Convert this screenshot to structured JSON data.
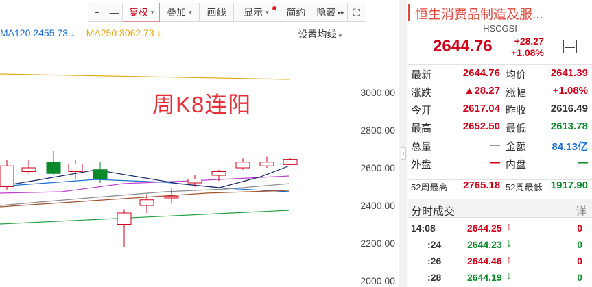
{
  "toolbar": {
    "zoom_in": "+",
    "zoom_out": "—",
    "fuquan": "复权",
    "diejia": "叠加",
    "huaxian": "画线",
    "xianshi": "显示",
    "jianyue": "简约",
    "yincang": "隐藏",
    "forward": "▸▸",
    "fullscreen": "⛶"
  },
  "ma_legend": {
    "ma120": "MA120:2455.73",
    "ma250": "MA250:3062.73",
    "arrow": "↓",
    "settings": "设置均线"
  },
  "annotation": "周K8连阳",
  "y_ticks": [
    "3000.00",
    "2800.00",
    "2600.00",
    "2400.00",
    "2200.00",
    "2000.00"
  ],
  "colors": {
    "up": "#d0021b",
    "down": "#0a8a2a",
    "ma120": "#1a6fd0",
    "ma250": "#e6a817"
  },
  "candles": [
    {
      "o": 2500,
      "c": 2610,
      "h": 2640,
      "l": 2480
    },
    {
      "o": 2580,
      "c": 2600,
      "h": 2640,
      "l": 2570
    },
    {
      "o": 2630,
      "c": 2570,
      "h": 2690,
      "l": 2560
    },
    {
      "o": 2580,
      "c": 2620,
      "h": 2640,
      "l": 2540
    },
    {
      "o": 2590,
      "c": 2540,
      "h": 2630,
      "l": 2520
    },
    {
      "o": 2300,
      "c": 2360,
      "h": 2380,
      "l": 2180
    },
    {
      "o": 2400,
      "c": 2430,
      "h": 2460,
      "l": 2360
    },
    {
      "o": 2440,
      "c": 2450,
      "h": 2490,
      "l": 2410
    },
    {
      "o": 2520,
      "c": 2540,
      "h": 2560,
      "l": 2500
    },
    {
      "o": 2560,
      "c": 2580,
      "h": 2590,
      "l": 2530
    },
    {
      "o": 2600,
      "c": 2630,
      "h": 2650,
      "l": 2590
    },
    {
      "o": 2610,
      "c": 2630,
      "h": 2660,
      "l": 2600
    },
    {
      "o": 2617,
      "c": 2645,
      "h": 2653,
      "l": 2614
    }
  ],
  "quote": {
    "title": "恒生消费品制造及服...",
    "code": "HSCGSI",
    "price": "2644.76",
    "change": "+28.27",
    "change_pct": "+1.08%",
    "collapse": "—",
    "rows": [
      {
        "k1": "最新",
        "v1": "2644.76",
        "c1": "red",
        "k2": "均价",
        "v2": "2641.39",
        "c2": "red"
      },
      {
        "k1": "涨跌",
        "v1": "▲28.27",
        "c1": "red",
        "k2": "涨幅",
        "v2": "+1.08%",
        "c2": "red"
      },
      {
        "k1": "今开",
        "v1": "2617.04",
        "c1": "red",
        "k2": "昨收",
        "v2": "2616.49",
        "c2": "dark"
      },
      {
        "k1": "最高",
        "v1": "2652.50",
        "c1": "red",
        "k2": "最低",
        "v2": "2613.78",
        "c2": "green"
      },
      {
        "k1": "总量",
        "v1": "—",
        "c1": "dark",
        "k2": "金额",
        "v2": "84.13亿",
        "c2": "blue"
      },
      {
        "k1": "外盘",
        "v1": "—",
        "c1": "red",
        "k2": "内盘",
        "v2": "—",
        "c2": "green"
      }
    ],
    "w52_high_label": "52周最高",
    "w52_high": "2765.18",
    "w52_low_label": "52周最低",
    "w52_low": "1917.90"
  },
  "ticks_section": {
    "title": "分时成交",
    "detail": "详",
    "rows": [
      {
        "time": "14:08",
        "price": "2644.25",
        "dir": "↑",
        "color": "red",
        "vol": "0",
        "vcolor": "red"
      },
      {
        "time": ":24",
        "price": "2644.23",
        "dir": "↓",
        "color": "green",
        "vol": "0",
        "vcolor": "green"
      },
      {
        "time": ":26",
        "price": "2644.46",
        "dir": "↑",
        "color": "red",
        "vol": "0",
        "vcolor": "red"
      },
      {
        "time": ":28",
        "price": "2644.19",
        "dir": "↓",
        "color": "green",
        "vol": "0",
        "vcolor": "green"
      }
    ]
  }
}
